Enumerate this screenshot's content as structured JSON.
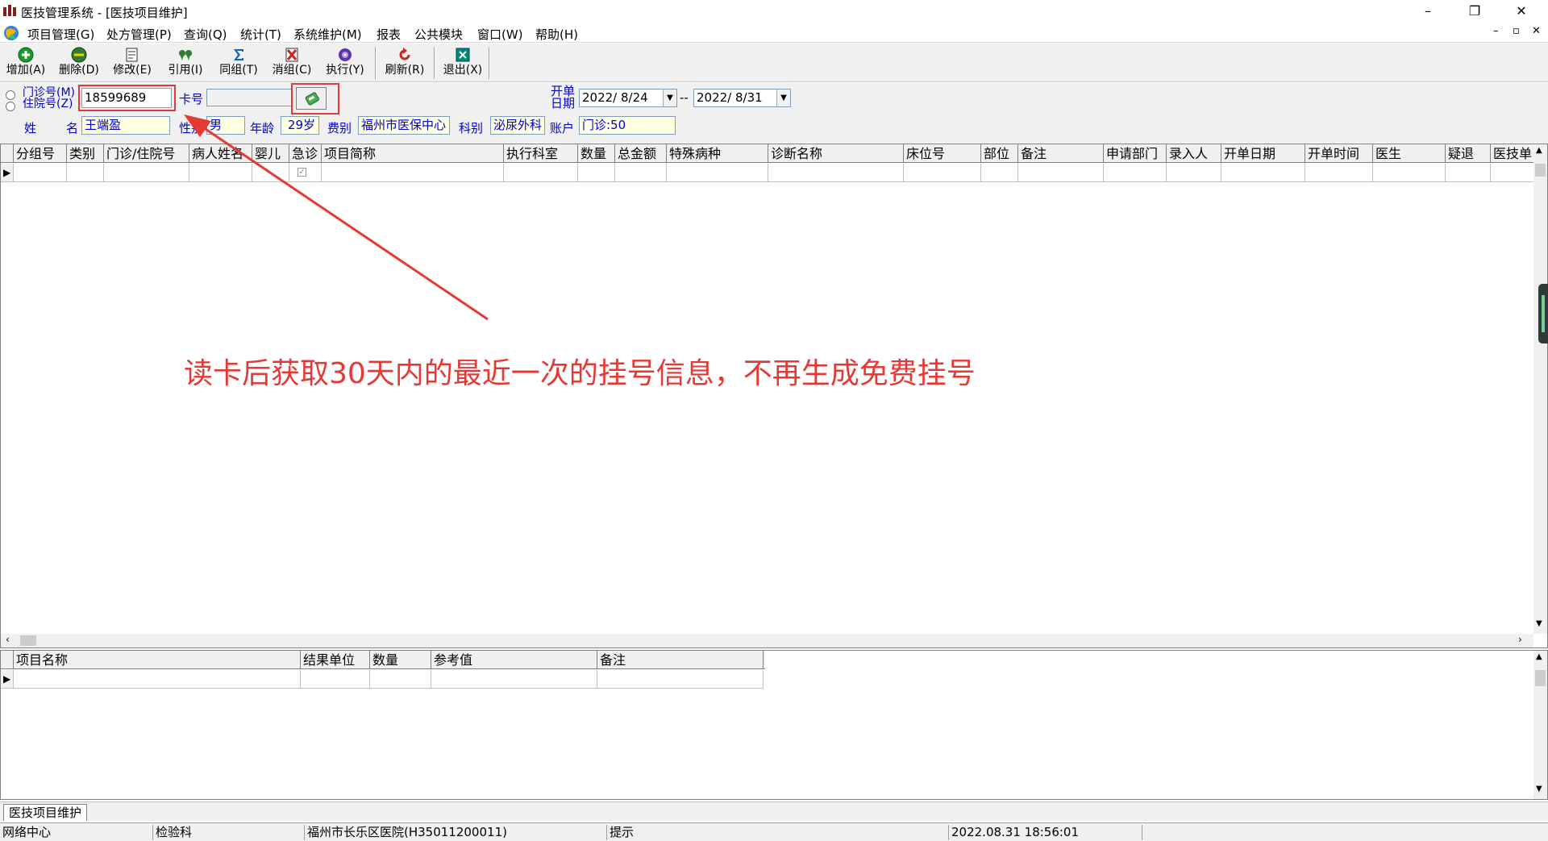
{
  "window": {
    "title": "医技管理系统 - [医技项目维护]",
    "minimize": "–",
    "restore": "❐",
    "close": "✕"
  },
  "menu": [
    "项目管理(G)",
    "处方管理(P)",
    "查询(Q)",
    "统计(T)",
    "系统维护(M)",
    "报表",
    "公共模块",
    "窗口(W)",
    "帮助(H)"
  ],
  "mdi_controls": [
    "–",
    "▫",
    "✕"
  ],
  "toolbar": [
    {
      "label": "增加(A)",
      "icon": "add-icon",
      "color": "#1a9a2a"
    },
    {
      "label": "删除(D)",
      "icon": "delete-icon",
      "color": "#2e7d32"
    },
    {
      "label": "修改(E)",
      "icon": "edit-icon",
      "color": "#555555"
    },
    {
      "label": "引用(I)",
      "icon": "quote-icon",
      "color": "#2e7d32"
    },
    {
      "label": "同组(T)",
      "icon": "sigma-icon",
      "color": "#1565c0"
    },
    {
      "label": "消组(C)",
      "icon": "cancel-group-icon",
      "color": "#c62828"
    },
    {
      "label": "执行(Y)",
      "icon": "execute-icon",
      "color": "#5e35b1"
    },
    {
      "label": "刷新(R)",
      "icon": "refresh-icon",
      "color": "#c62828"
    },
    {
      "label": "退出(X)",
      "icon": "exit-icon",
      "color": "#00897b"
    }
  ],
  "form": {
    "radio_outpatient": "门诊号(M)",
    "radio_inpatient": "住院号(Z)",
    "patient_no": "18599689",
    "card_label": "卡号",
    "card_no": "",
    "open_date_label_1": "开单",
    "open_date_label_2": "日期",
    "date_from": "2022/ 8/24",
    "date_sep": "--",
    "date_to": "2022/ 8/31",
    "name_label_1": "姓",
    "name_label_2": "名",
    "name": "王端盈",
    "sex_label": "性别",
    "sex": "男",
    "age_label": "年龄",
    "age": "29岁",
    "fee_type_label": "费别",
    "fee_type": "福州市医保中心",
    "dept_label": "科别",
    "dept": "泌尿外科",
    "account_label": "账户",
    "account": "门诊:50"
  },
  "main_grid": {
    "columns": [
      "分组号",
      "类别",
      "门诊/住院号",
      "病人姓名",
      "婴儿",
      "急诊",
      "项目简称",
      "执行科室",
      "数量",
      "总金额",
      "特殊病种",
      "诊断名称",
      "床位号",
      "部位",
      "备注",
      "申请部门",
      "录入人",
      "开单日期",
      "开单时间",
      "医生",
      "疑退",
      "医技单"
    ]
  },
  "detail_grid": {
    "columns": [
      "项目名称",
      "结果单位",
      "数量",
      "参考值",
      "备注"
    ]
  },
  "annotation": "读卡后获取30天内的最近一次的挂号信息，不再生成免费挂号",
  "tab": "医技项目维护",
  "status": [
    "网络中心",
    "检验科",
    "福州市长乐区医院(H35011200011)",
    "提示",
    "2022.08.31 18:56:01"
  ],
  "colors": {
    "accent_red": "#e53935",
    "label_blue": "#0000cc"
  }
}
